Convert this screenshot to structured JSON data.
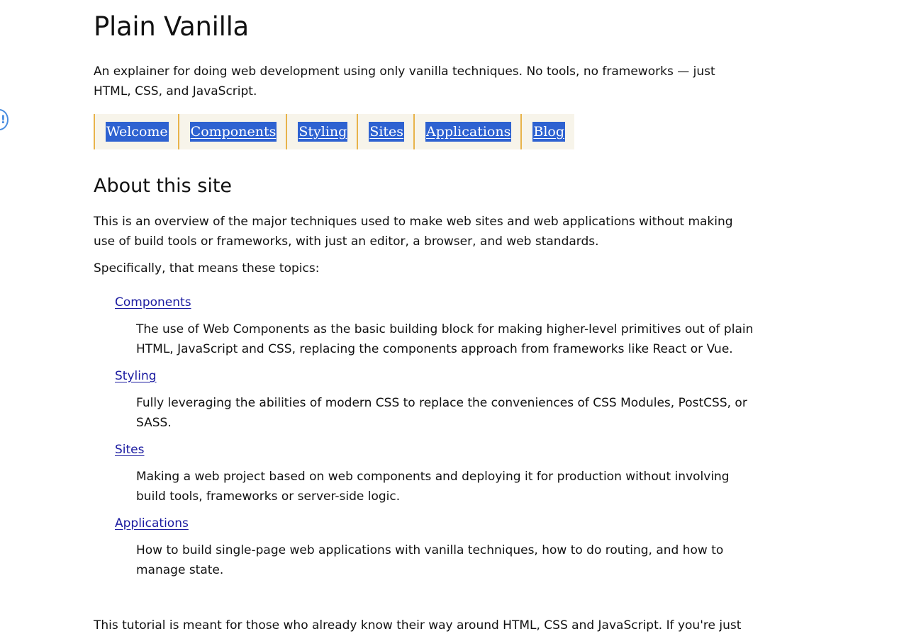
{
  "header": {
    "title": "Plain Vanilla",
    "tagline": "An explainer for doing web development using only vanilla techniques. No tools, no frameworks — just HTML, CSS, and JavaScript."
  },
  "nav": {
    "items": [
      {
        "label": "Welcome",
        "current": true
      },
      {
        "label": "Components",
        "current": false
      },
      {
        "label": "Styling",
        "current": false
      },
      {
        "label": "Sites",
        "current": false
      },
      {
        "label": "Applications",
        "current": false
      },
      {
        "label": "Blog",
        "current": false
      }
    ]
  },
  "main": {
    "section_title": "About this site",
    "intro": "This is an overview of the major techniques used to make web sites and web applications without making use of build tools or frameworks, with just an editor, a browser, and web standards.",
    "lead": "Specifically, that means these topics:",
    "topics": [
      {
        "term": "Components",
        "description": "The use of Web Components as the basic building block for making higher-level primitives out of plain HTML, JavaScript and CSS, replacing the components approach from frameworks like React or Vue."
      },
      {
        "term": "Styling",
        "description": "Fully leveraging the abilities of modern CSS to replace the conveniences of CSS Modules, PostCSS, or SASS."
      },
      {
        "term": "Sites",
        "description": "Making a web project based on web components and deploying it for production without involving build tools, frameworks or server-side logic."
      },
      {
        "term": "Applications",
        "description": "How to build single-page web applications with vanilla techniques, how to do routing, and how to manage state."
      }
    ],
    "outro": "This tutorial is meant for those who already know their way around HTML, CSS and JavaScript. If you're just"
  },
  "colors": {
    "nav_highlight": "#2e62d1",
    "nav_border": "#e8b34a",
    "nav_background": "#f7f4ea",
    "link": "#1a1aa0"
  },
  "icons": {
    "side_badge": "alert-icon"
  }
}
